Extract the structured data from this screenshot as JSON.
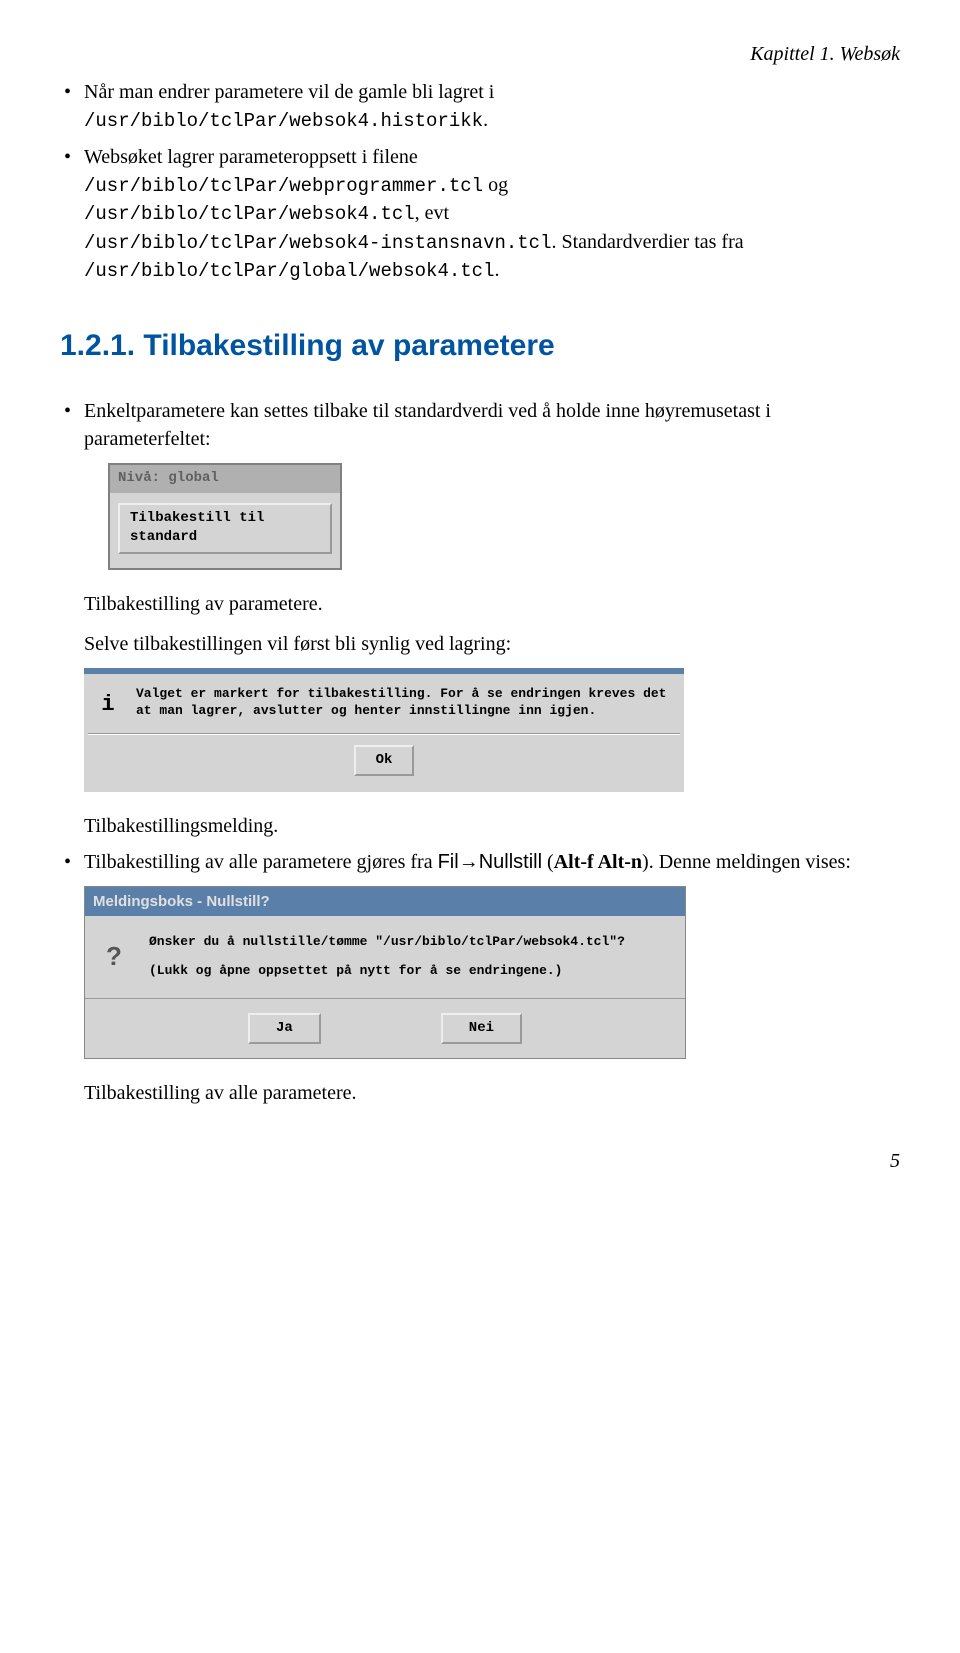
{
  "header": {
    "chapter": "Kapittel 1. Websøk"
  },
  "bullets1": {
    "item1_text": "Når man endrer parametere vil de gamle bli lagret i ",
    "item1_path": "/usr/biblo/tclPar/websok4.historikk",
    "item1_period": ".",
    "item2_text1": "Websøket lagrer parameteroppsett i filene ",
    "item2_path1": "/usr/biblo/tclPar/webprogrammer.tcl",
    "item2_word_og": " og ",
    "item2_path2": "/usr/biblo/tclPar/websok4.tcl",
    "item2_word_evt": ", evt ",
    "item2_path3": "/usr/biblo/tclPar/websok4-instansnavn.tcl",
    "item2_tail": ". Standardverdier tas fra ",
    "item2_path4": "/usr/biblo/tclPar/global/websok4.tcl",
    "item2_period": "."
  },
  "section": {
    "number": "1.2.1.",
    "title": "Tilbakestilling av parametere"
  },
  "bullets2": {
    "item1": "Enkeltparametere kan settes tilbake til standardverdi ved å holde inne høyremusetast i parameterfeltet:"
  },
  "dialog1": {
    "title": "Nivå: global",
    "button": "Tilbakestill til standard"
  },
  "captions": {
    "c1": "Tilbakestilling av parametere.",
    "c2": "Selve tilbakestillingen vil først bli synlig ved lagring:",
    "c3": "Tilbakestillingsmelding."
  },
  "dialog2": {
    "icon": "i",
    "msg": "Valget er markert for tilbakestilling. For å se endringen kreves det at man lagrer, avslutter og henter innstillingne inn igjen.",
    "ok": "Ok"
  },
  "bullets3": {
    "item1_a": "Tilbakestilling av alle parametere gjøres fra ",
    "item1_menu1": "Fil",
    "item1_arrow": "→",
    "item1_menu2": "Nullstill",
    "item1_b": " (",
    "item1_bold": "Alt-f Alt-n",
    "item1_c": "). Denne meldingen vises:"
  },
  "dialog3": {
    "title": "Meldingsboks - Nullstill?",
    "icon": "?",
    "msg1": "Ønsker du å nullstille/tømme \"/usr/biblo/tclPar/websok4.tcl\"?",
    "msg2": "(Lukk og åpne oppsettet på nytt for å se endringene.)",
    "yes": "Ja",
    "no": "Nei"
  },
  "captions2": {
    "final": "Tilbakestilling av alle parametere."
  },
  "page": {
    "num": "5"
  }
}
